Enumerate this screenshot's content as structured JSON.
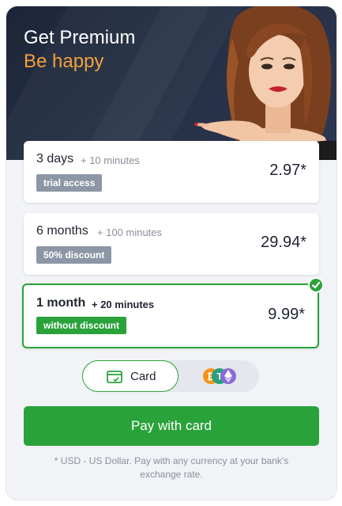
{
  "header": {
    "title": "Get Premium",
    "subtitle": "Be happy"
  },
  "plans": [
    {
      "period": "3 days",
      "bonus": "+ 10 minutes",
      "badge": "trial access",
      "price": "2.97*",
      "selected": false
    },
    {
      "period": "6 months",
      "bonus": "+ 100 minutes",
      "badge": "50% discount",
      "price": "29.94*",
      "selected": false
    },
    {
      "period": "1 month",
      "bonus": "+ 20 minutes",
      "badge": "without discount",
      "price": "9.99*",
      "selected": true
    }
  ],
  "payment_method": {
    "card_label": "Card",
    "selected": "card",
    "crypto_icons": [
      "bitcoin-icon",
      "tether-icon",
      "ethereum-icon"
    ]
  },
  "pay_button_label": "Pay with card",
  "footnote": "* USD - US Dollar. Pay with any currency at your bank's exchange rate.",
  "colors": {
    "accent_green": "#2aa23a",
    "hero_dark": "#1d2638",
    "subtitle_orange": "#f3a03c",
    "badge_gray": "#8d96a6"
  }
}
